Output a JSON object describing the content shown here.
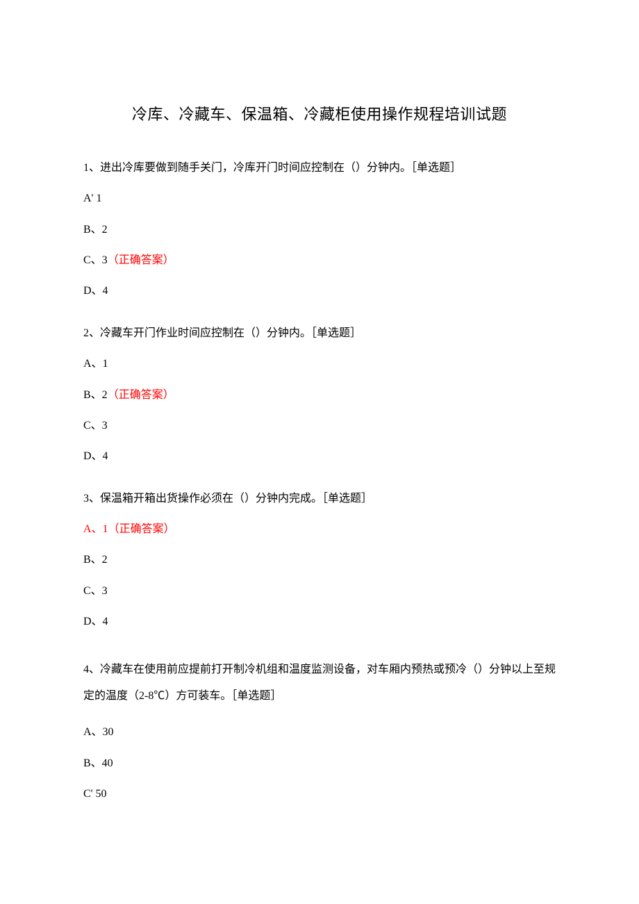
{
  "title": "冷库、冷藏车、保温箱、冷藏柜使用操作规程培训试题",
  "correct_label": "（正确答案）",
  "questions": [
    {
      "text": "1、进出冷库要做到随手关门，冷库开门时间应控制在（）分钟内。［单选题］",
      "options": [
        {
          "pre": "A' 1",
          "correct": false
        },
        {
          "pre": "B、2",
          "correct": false
        },
        {
          "pre": "C、3",
          "correct": true
        },
        {
          "pre": "D、4",
          "correct": false
        }
      ]
    },
    {
      "text": "2、冷藏车开门作业时间应控制在（）分钟内。［单选题］",
      "options": [
        {
          "pre": "A、1",
          "correct": false
        },
        {
          "pre": "B、2",
          "correct": true
        },
        {
          "pre": "C、3",
          "correct": false
        },
        {
          "pre": "D、4",
          "correct": false
        }
      ]
    },
    {
      "text": "3、保温箱开箱出货操作必须在（）分钟内完成。［单选题］",
      "options": [
        {
          "pre": "A、1",
          "correct": true
        },
        {
          "pre": "B、2",
          "correct": false
        },
        {
          "pre": "C、3",
          "correct": false
        },
        {
          "pre": "D、4",
          "correct": false
        }
      ]
    },
    {
      "text": "4、冷藏车在使用前应提前打开制冷机组和温度监测设备，对车厢内预热或预冷（）分钟以上至规定的温度（2-8℃）方可装车。［单选题］",
      "options": [
        {
          "pre": "A、30",
          "correct": false
        },
        {
          "pre": "B、40",
          "correct": false
        },
        {
          "pre": "C' 50",
          "correct": false
        }
      ]
    }
  ]
}
